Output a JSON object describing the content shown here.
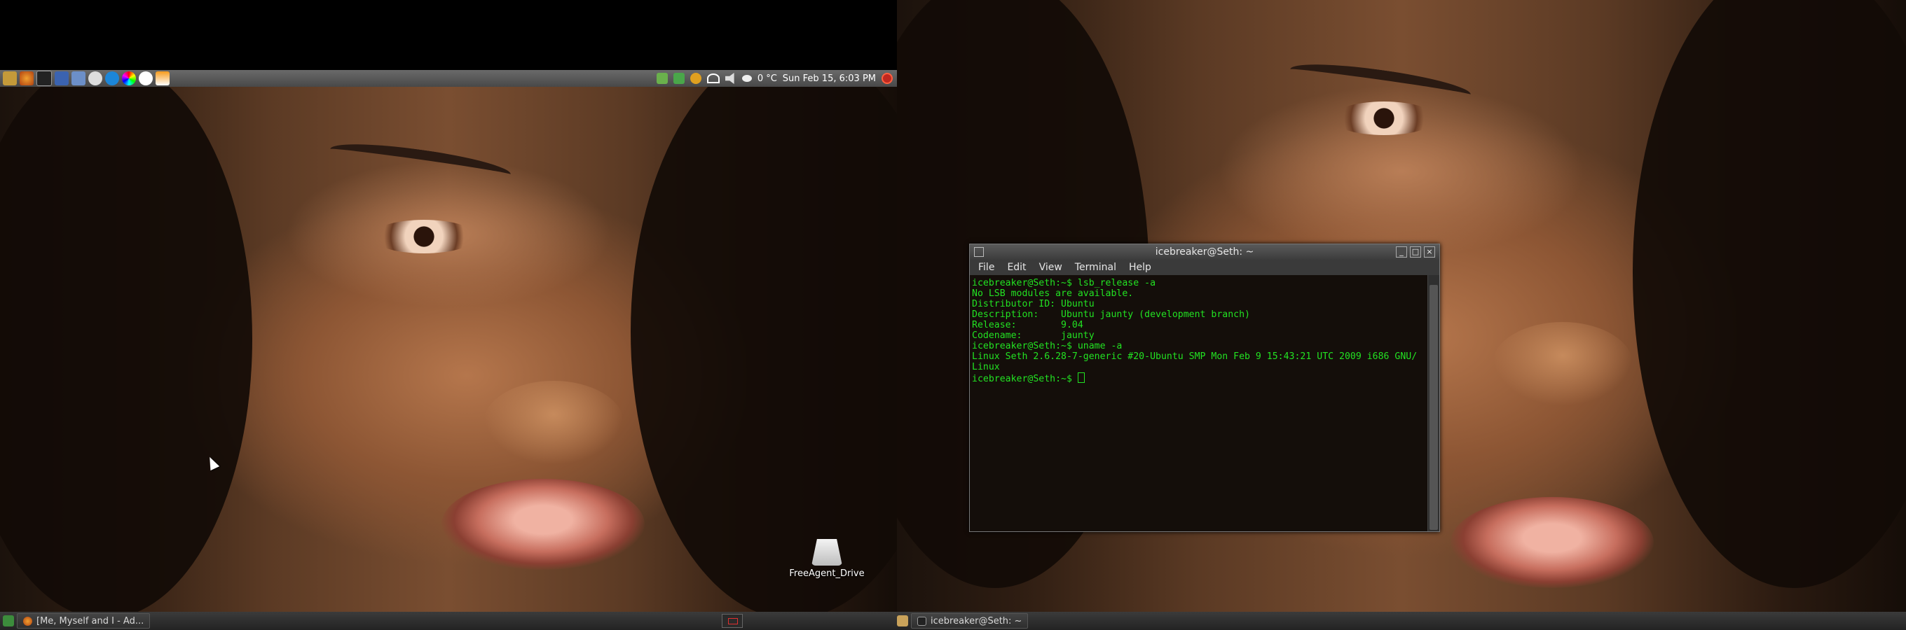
{
  "top_panel": {
    "temperature": "0 °C",
    "clock": "Sun Feb 15,  6:03 PM",
    "launchers": [
      "ubuntu-menu-icon",
      "firefox-icon",
      "terminal-icon",
      "file-manager-icon",
      "home-folder-icon",
      "chat-icon",
      "skype-icon",
      "color-picker-icon",
      "media-player-icon",
      "vlc-icon"
    ],
    "tray_icons": [
      "notes-icon",
      "network-manager-icon",
      "update-icon",
      "wifi-icon",
      "volume-icon",
      "weather-icon"
    ]
  },
  "desktop": {
    "icon_label": "FreeAgent_Drive"
  },
  "left_taskbar": {
    "task_label": "[Me, Myself and I - Ad..."
  },
  "right_taskbar": {
    "task_label": "icebreaker@Seth: ~"
  },
  "terminal": {
    "title": "icebreaker@Seth: ~",
    "menu": [
      "File",
      "Edit",
      "View",
      "Terminal",
      "Help"
    ],
    "lines": [
      "icebreaker@Seth:~$ lsb_release -a",
      "No LSB modules are available.",
      "Distributor ID: Ubuntu",
      "Description:    Ubuntu jaunty (development branch)",
      "Release:        9.04",
      "Codename:       jaunty",
      "icebreaker@Seth:~$ uname -a",
      "Linux Seth 2.6.28-7-generic #20-Ubuntu SMP Mon Feb 9 15:43:21 UTC 2009 i686 GNU/",
      "Linux"
    ],
    "prompt": "icebreaker@Seth:~$ "
  }
}
